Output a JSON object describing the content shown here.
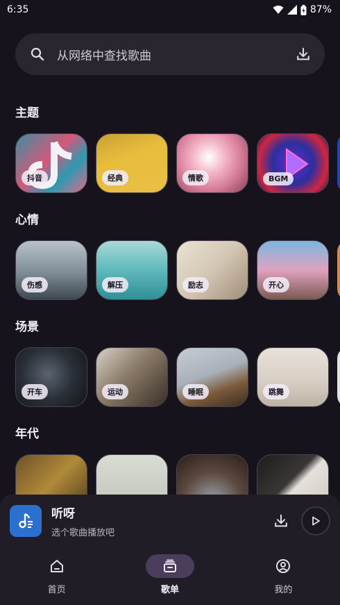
{
  "status_bar": {
    "time": "6:35",
    "battery": "87%"
  },
  "search": {
    "placeholder": "从网络中查找歌曲",
    "search_icon": "search-icon",
    "download_icon": "download-icon"
  },
  "sections": [
    {
      "title": "主题",
      "cards": [
        "抖音",
        "经典",
        "情歌",
        "BGM"
      ]
    },
    {
      "title": "心情",
      "cards": [
        "伤感",
        "解压",
        "励志",
        "开心"
      ]
    },
    {
      "title": "场景",
      "cards": [
        "开车",
        "运动",
        "睡眠",
        "跳舞"
      ]
    },
    {
      "title": "年代",
      "cards": []
    }
  ],
  "player": {
    "title": "听呀",
    "subtitle": "选个歌曲播放吧"
  },
  "nav": [
    {
      "label": "首页",
      "icon": "home-icon"
    },
    {
      "label": "歌单",
      "icon": "playlist-icon",
      "active": true
    },
    {
      "label": "我的",
      "icon": "profile-icon"
    }
  ],
  "colors": {
    "background": "#16131c",
    "surface": "#211d27",
    "search_bg": "#2a2630",
    "nav_active": "#4b3d5c",
    "player_art": "#2b6fcf"
  }
}
